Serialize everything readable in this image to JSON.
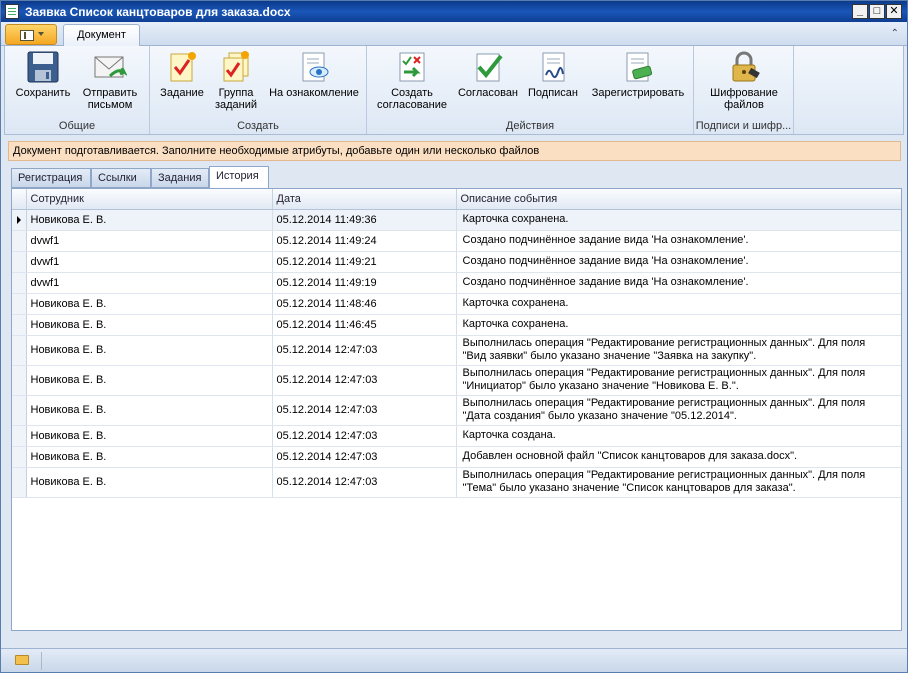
{
  "window": {
    "title": "Заявка Список канцтоваров для заказа.docx",
    "minimize": "_",
    "maximize": "□",
    "close": "✕"
  },
  "ribbon_tabs": [
    "Документ"
  ],
  "ribbon": {
    "groups": [
      {
        "label": "Общие",
        "buttons": [
          {
            "label": "Сохранить",
            "icon": "floppy-disk-icon"
          },
          {
            "label": "Отправить письмом",
            "line1": "Отправить",
            "line2": "письмом",
            "icon": "envelope-send-icon"
          }
        ]
      },
      {
        "label": "Создать",
        "buttons": [
          {
            "label": "Задание",
            "icon": "task-icon"
          },
          {
            "label": "Группа заданий",
            "line1": "Группа",
            "line2": "заданий",
            "icon": "task-group-icon"
          },
          {
            "label": "На ознакомление",
            "icon": "review-eye-icon"
          }
        ]
      },
      {
        "label": "Действия",
        "buttons": [
          {
            "label": "Создать согласование",
            "line1": "Создать",
            "line2": "согласование",
            "icon": "create-approval-icon"
          },
          {
            "label": "Согласован",
            "icon": "approved-check-icon"
          },
          {
            "label": "Подписан",
            "icon": "signed-icon"
          },
          {
            "label": "Зарегистрировать",
            "icon": "register-icon"
          }
        ]
      },
      {
        "label": "Подписи и шифр...",
        "buttons": [
          {
            "label": "Шифрование файлов",
            "line1": "Шифрование",
            "line2": "файлов",
            "icon": "padlock-icon"
          }
        ]
      }
    ]
  },
  "notice": "Документ подготавливается. Заполните необходимые атрибуты, добавьте один или несколько файлов",
  "panel_tabs": [
    "Регистрация",
    "Ссылки",
    "Задания",
    "История"
  ],
  "history": {
    "columns": [
      "Сотрудник",
      "Дата",
      "Описание события"
    ],
    "rows": [
      {
        "employee": "Новикова Е. В.",
        "date": "05.12.2014 11:49:36",
        "desc1": "Карточка сохранена.",
        "desc2": ""
      },
      {
        "employee": "dvwf1",
        "date": "05.12.2014 11:49:24",
        "desc1": "Создано подчинённое задание вида 'На ознакомление'.",
        "desc2": ""
      },
      {
        "employee": "dvwf1",
        "date": "05.12.2014 11:49:21",
        "desc1": "Создано подчинённое задание вида 'На ознакомление'.",
        "desc2": ""
      },
      {
        "employee": "dvwf1",
        "date": "05.12.2014 11:49:19",
        "desc1": "Создано подчинённое задание вида 'На ознакомление'.",
        "desc2": ""
      },
      {
        "employee": "Новикова Е. В.",
        "date": "05.12.2014 11:48:46",
        "desc1": "Карточка сохранена.",
        "desc2": ""
      },
      {
        "employee": "Новикова Е. В.",
        "date": "05.12.2014 11:46:45",
        "desc1": "Карточка сохранена.",
        "desc2": ""
      },
      {
        "employee": "Новикова Е. В.",
        "date": "05.12.2014 12:47:03",
        "desc1": "Выполнилась операция \"Редактирование регистрационных данных\". Для поля",
        "desc2": "\"Вид заявки\" было указано значение \"Заявка на закупку\"."
      },
      {
        "employee": "Новикова Е. В.",
        "date": "05.12.2014 12:47:03",
        "desc1": "Выполнилась операция \"Редактирование регистрационных данных\". Для поля",
        "desc2": "\"Инициатор\" было указано значение \"Новикова Е. В.\"."
      },
      {
        "employee": "Новикова Е. В.",
        "date": "05.12.2014 12:47:03",
        "desc1": "Выполнилась операция \"Редактирование регистрационных данных\". Для поля",
        "desc2": "\"Дата создания\" было указано значение \"05.12.2014\"."
      },
      {
        "employee": "Новикова Е. В.",
        "date": "05.12.2014 12:47:03",
        "desc1": "Карточка создана.",
        "desc2": ""
      },
      {
        "employee": "Новикова Е. В.",
        "date": "05.12.2014 12:47:03",
        "desc1": "Добавлен основной файл \"Список канцтоваров для заказа.docx\".",
        "desc2": ""
      },
      {
        "employee": "Новикова Е. В.",
        "date": "05.12.2014 12:47:03",
        "desc1": "Выполнилась операция \"Редактирование регистрационных данных\". Для поля",
        "desc2": "\"Тема\" было указано значение \"Список канцтоваров для заказа\"."
      }
    ]
  },
  "colors": {
    "title_bar": "#1a56b8",
    "notice_bg": "#fbdfc2",
    "app_button": "#f4a722"
  }
}
